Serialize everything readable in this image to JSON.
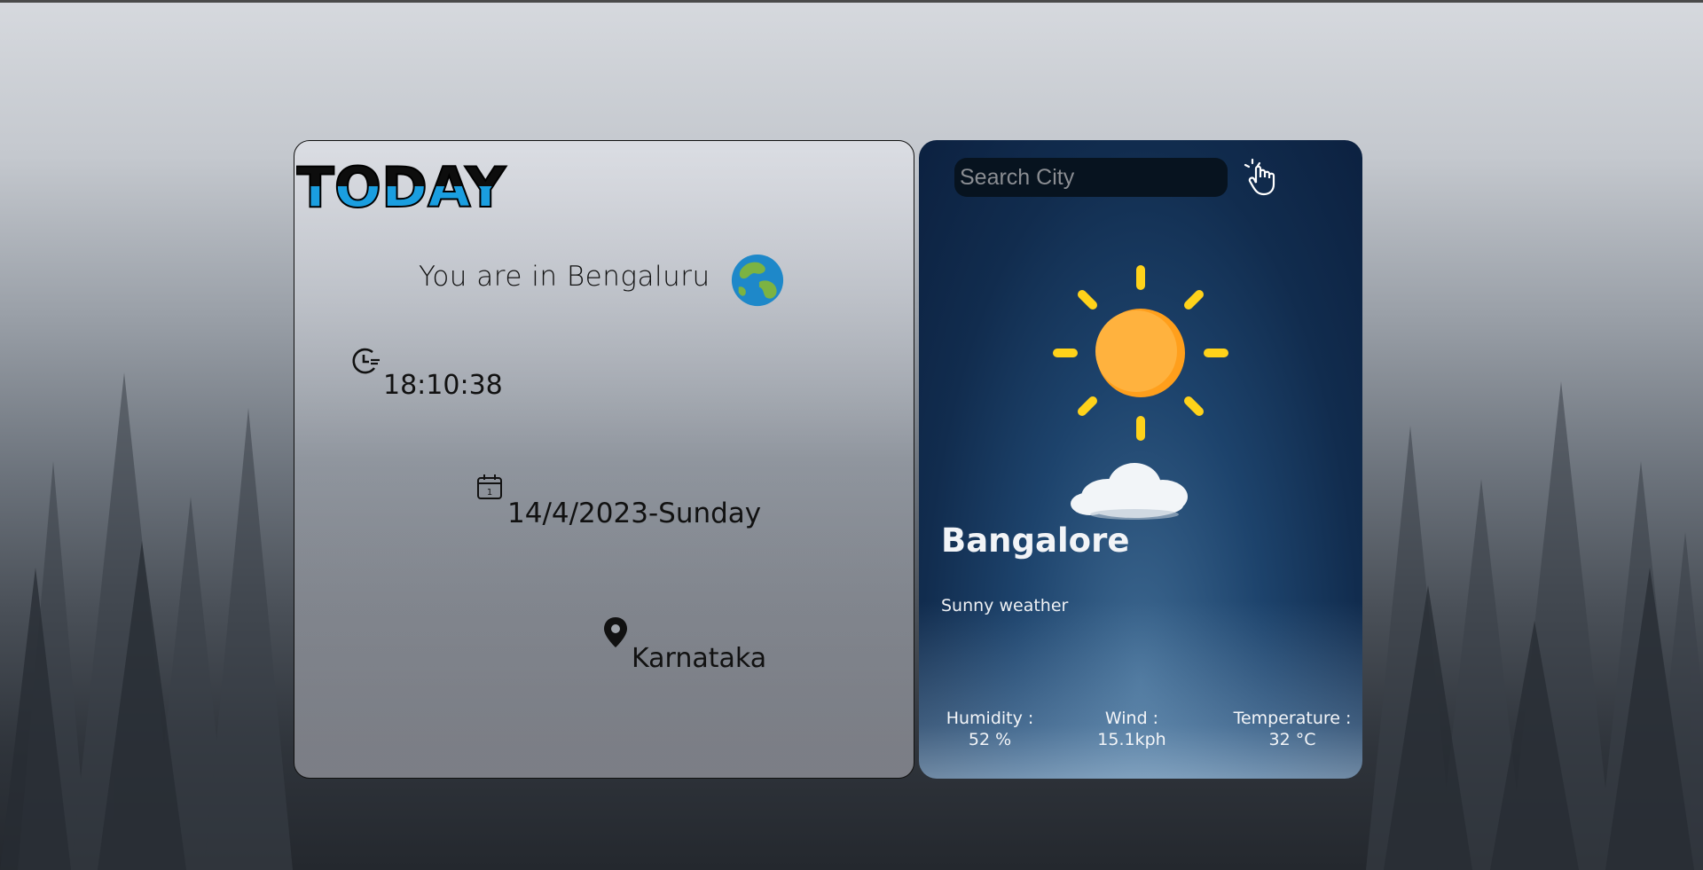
{
  "left_card": {
    "logo_text": "TODAY",
    "location_line": "You are in Bengaluru",
    "time": "18:10:38",
    "date": "14/4/2023-Sunday",
    "region": "Karnataka",
    "icons": [
      "globe-icon",
      "clock-icon",
      "calendar-icon",
      "location-pin-icon"
    ]
  },
  "right_card": {
    "search": {
      "placeholder": "Search City",
      "value": ""
    },
    "search_button_icon": "pointer-hand-icon",
    "weather_icon": "sun-with-cloud-icon",
    "city": "Bangalore",
    "condition": "Sunny weather",
    "stats": {
      "humidity_label": "Humidity :",
      "humidity_value": "52 %",
      "wind_label": "Wind :",
      "wind_value": "15.1kph",
      "temperature_label": "Temperature :",
      "temperature_value": "32 °C"
    }
  },
  "colors": {
    "logo_blue": "#1a9ee0",
    "sun": "#ffb23e",
    "sun_rays": "#ffd21a",
    "card_dark": "#112c4e"
  }
}
